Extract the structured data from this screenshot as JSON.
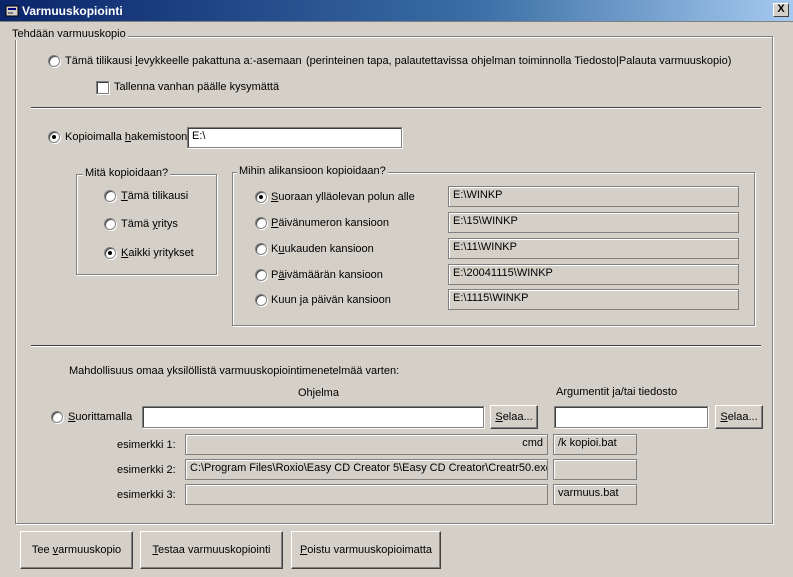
{
  "window": {
    "title": "Varmuuskopiointi",
    "close_glyph": "X"
  },
  "backup_frame": {
    "label": "Tehdään varmuuskopio"
  },
  "floppy": {
    "label": "Tämä tilikausi levykkeelle pakattuna a:-asemaan",
    "note": "(perinteinen tapa, palautettavissa ohjelman toiminnolla Tiedosto|Palauta varmuuskopio)",
    "overwrite_label": "Tallenna vanhan päälle kysymättä",
    "selected": false,
    "overwrite_checked": false
  },
  "directory": {
    "label_pre": "Kopioimalla ",
    "label_ul": "h",
    "label_post": "akemistoon",
    "value": "E:\\",
    "selected": true
  },
  "what_frame": {
    "label": "Mitä kopioidaan?",
    "options": [
      {
        "label": "Tämä tilikausi",
        "selected": false
      },
      {
        "label": "Tämä yritys",
        "selected": false
      },
      {
        "label": "Kaikki yritykset",
        "selected": true
      }
    ]
  },
  "sub_frame": {
    "label": "Mihin alikansioon kopioidaan?",
    "options": [
      {
        "label": "Suoraan ylläolevan polun alle",
        "path": "E:\\WINKP",
        "selected": true
      },
      {
        "label": "Päivänumeron kansioon",
        "path": "E:\\15\\WINKP",
        "selected": false
      },
      {
        "label": "Kuukauden kansioon",
        "path": "E:\\11\\WINKP",
        "selected": false
      },
      {
        "label": "Päivämäärän kansioon",
        "path": "E:\\20041115\\WINKP",
        "selected": false
      },
      {
        "label": "Kuun ja päivän kansioon",
        "path": "E:\\1115\\WINKP",
        "selected": false
      }
    ]
  },
  "custom": {
    "intro": "Mahdollisuus omaa yksilöllistä varmuuskopiointimenetelmää varten:",
    "program_header": "Ohjelma",
    "args_header": "Argumentit ja/tai tiedosto",
    "run_label": "Suorittamalla",
    "run_selected": false,
    "program_value": "",
    "args_value": "",
    "browse_label": "Selaa...",
    "examples": [
      {
        "label": "esimerkki 1:",
        "program": "cmd",
        "args": "/k kopioi.bat"
      },
      {
        "label": "esimerkki 2:",
        "program": "C:\\Program Files\\Roxio\\Easy CD Creator 5\\Easy CD Creator\\Creatr50.exe",
        "args": ""
      },
      {
        "label": "esimerkki 3:",
        "program": "",
        "args": "varmuus.bat"
      }
    ]
  },
  "buttons": {
    "make": "Tee varmuuskopio",
    "test": "Testaa varmuuskopiointi",
    "exit": "Poistu varmuuskopioimatta"
  }
}
